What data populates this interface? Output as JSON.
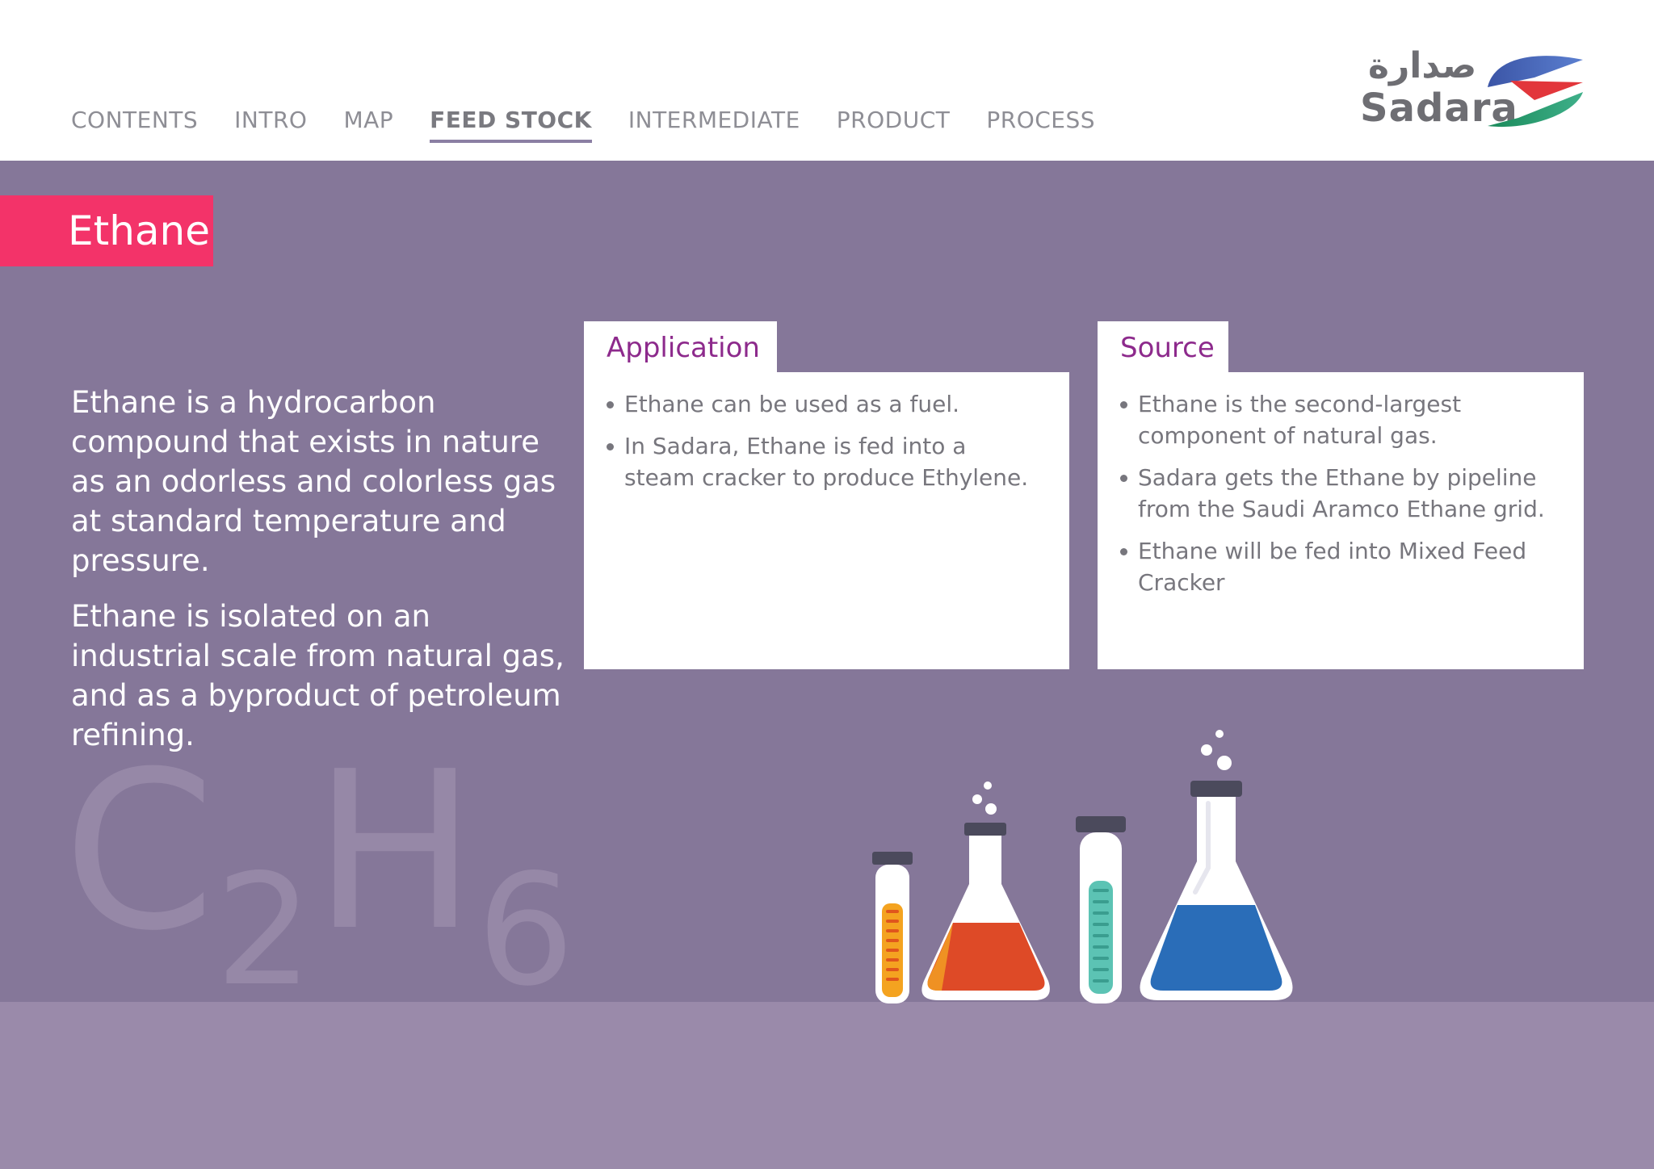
{
  "nav": {
    "items": [
      {
        "label": "CONTENTS",
        "active": false
      },
      {
        "label": "INTRO",
        "active": false
      },
      {
        "label": "MAP",
        "active": false
      },
      {
        "label": "FEED STOCK",
        "active": true
      },
      {
        "label": "INTERMEDIATE",
        "active": false
      },
      {
        "label": "PRODUCT",
        "active": false
      },
      {
        "label": "PROCESS",
        "active": false
      }
    ]
  },
  "logo": {
    "arabic": "صدارة",
    "english": "Sadara"
  },
  "page": {
    "title": "Ethane"
  },
  "intro": {
    "paragraph1": "Ethane is a hydrocarbon compound that exists in nature as an odorless and colorless gas at standard temperature and pressure.",
    "paragraph2": "Ethane is isolated on an industrial scale from natural gas, and as a byproduct of petroleum refining."
  },
  "formula": {
    "c": "C",
    "c_sub": "2",
    "h": "H",
    "h_sub": "6"
  },
  "application": {
    "title": "Application",
    "bullets": [
      "Ethane can be used as a fuel.",
      "In Sadara, Ethane is fed into a steam cracker to produce Ethylene."
    ]
  },
  "source": {
    "title": "Source",
    "bullets": [
      "Ethane is the second-largest component of natural gas.",
      "Sadara gets the Ethane by pipeline from the Saudi Aramco Ethane grid.",
      "Ethane will be fed into Mixed Feed Cracker"
    ]
  },
  "colors": {
    "accent_pink": "#f33369",
    "background_purple": "#857799",
    "floor_purple": "#9a8aaa",
    "card_title_purple": "#8d2a8c"
  },
  "icons": [
    "sadara-logo-icon",
    "test-tube-orange-icon",
    "flask-red-icon",
    "test-tube-teal-icon",
    "flask-blue-icon"
  ]
}
